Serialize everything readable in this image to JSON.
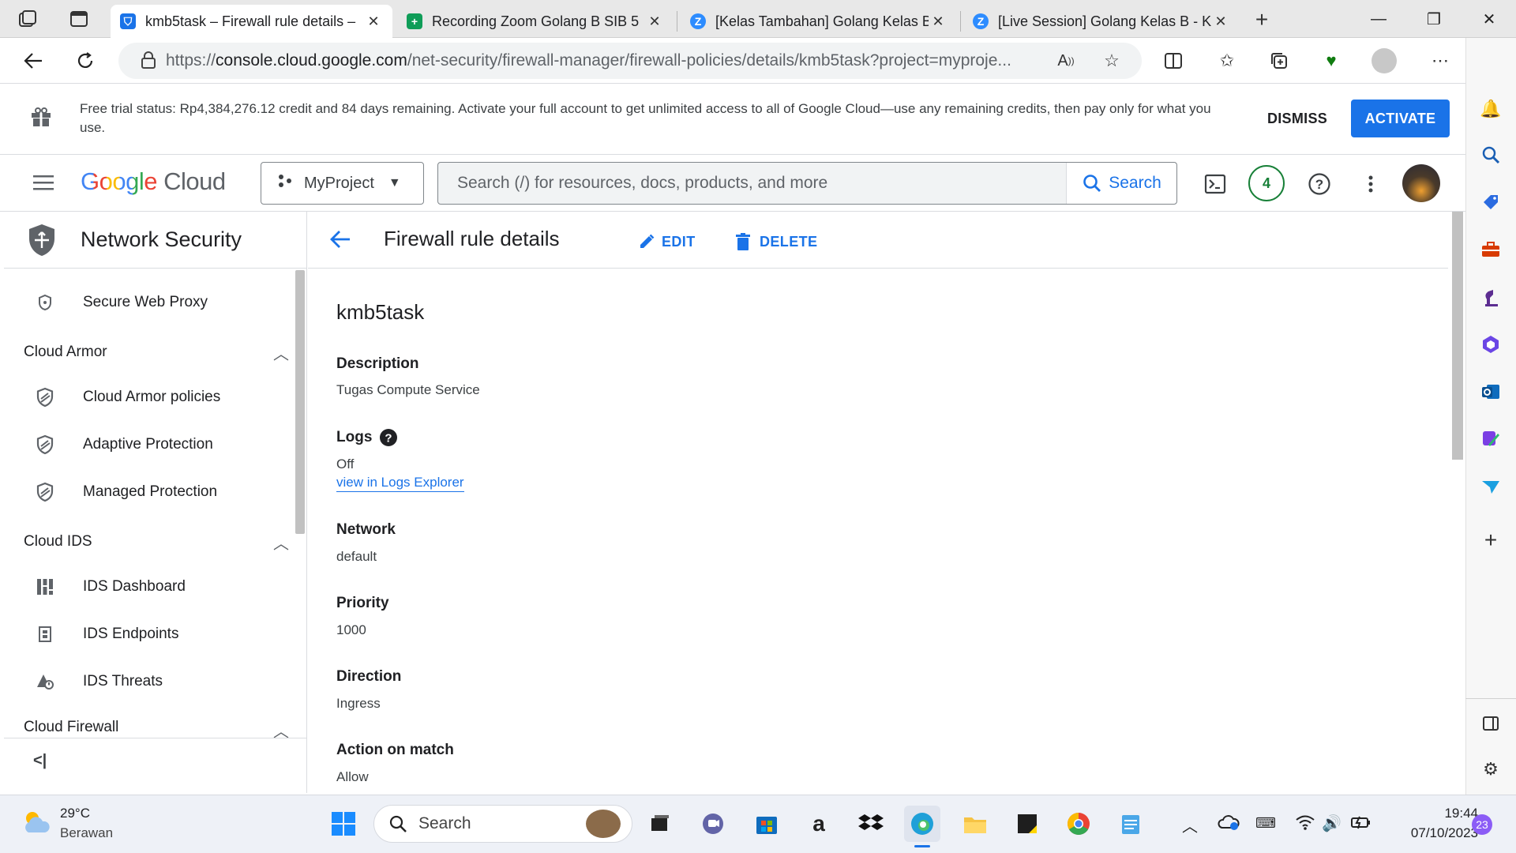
{
  "browser": {
    "tabs": [
      {
        "title": "kmb5task – Firewall rule details –",
        "active": true
      },
      {
        "title": "Recording Zoom Golang B SIB 5 ",
        "active": false
      },
      {
        "title": "[Kelas Tambahan] Golang Kelas B",
        "active": false
      },
      {
        "title": "[Live Session] Golang Kelas B - Ka",
        "active": false
      }
    ],
    "url_prefix": "https://",
    "url_host": "console.cloud.google.com",
    "url_path": "/net-security/firewall-manager/firewall-policies/details/kmb5task?project=myproje..."
  },
  "banner": {
    "text": "Free trial status: Rp4,384,276.12 credit and 84 days remaining. Activate your full account to get unlimited access to all of Google Cloud—use any remaining credits, then pay only for what you use.",
    "dismiss": "DISMISS",
    "activate": "ACTIVATE"
  },
  "header": {
    "logo_google": "Google",
    "logo_cloud": "Cloud",
    "project": "MyProject",
    "search_placeholder": "Search (/) for resources, docs, products, and more",
    "search_button": "Search",
    "notification_count": "4"
  },
  "sidebar": {
    "title": "Network Security",
    "items": [
      {
        "label": "Secure Web Proxy",
        "icon": "proxy-icon"
      },
      {
        "group": "Cloud Armor"
      },
      {
        "label": "Cloud Armor policies",
        "icon": "shield-icon"
      },
      {
        "label": "Adaptive Protection",
        "icon": "shield-icon"
      },
      {
        "label": "Managed Protection",
        "icon": "shield-icon"
      },
      {
        "group": "Cloud IDS"
      },
      {
        "label": "IDS Dashboard",
        "icon": "dashboard-icon"
      },
      {
        "label": "IDS Endpoints",
        "icon": "endpoint-icon"
      },
      {
        "label": "IDS Threats",
        "icon": "threat-icon"
      },
      {
        "group": "Cloud Firewall"
      }
    ],
    "collapse": "<|"
  },
  "main": {
    "title": "Firewall rule details",
    "edit": "EDIT",
    "delete": "DELETE",
    "rule_name": "kmb5task",
    "fields": [
      {
        "label": "Description",
        "value": "Tugas Compute Service"
      },
      {
        "label": "Logs",
        "value": "Off",
        "link": "view in Logs Explorer"
      },
      {
        "label": "Network",
        "value": "default"
      },
      {
        "label": "Priority",
        "value": "1000"
      },
      {
        "label": "Direction",
        "value": "Ingress"
      },
      {
        "label": "Action on match",
        "value": "Allow"
      }
    ]
  },
  "taskbar": {
    "weather_temp": "29°C",
    "weather_desc": "Berawan",
    "search": "Search",
    "time": "19:44",
    "date": "07/10/2023",
    "notif_count": "23"
  },
  "colors": {
    "accent": "#1a73e8",
    "google_blue": "#4285f4",
    "google_red": "#ea4335",
    "google_yellow": "#fbbc04",
    "google_green": "#34a853"
  }
}
